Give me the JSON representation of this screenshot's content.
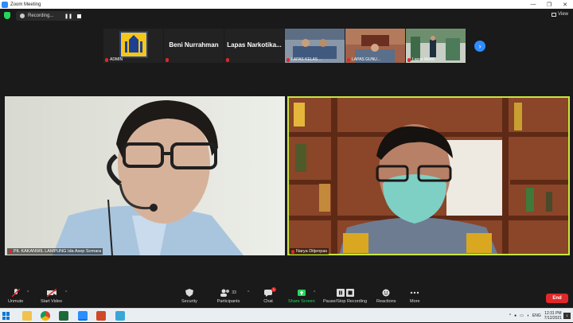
{
  "window": {
    "title": "Zoom Meeting",
    "minimize": "—",
    "maximize": "❐",
    "close": "✕"
  },
  "topbar": {
    "recording_label": "Recording...",
    "pause_glyph": "❚❚",
    "view_label": "View"
  },
  "thumbnails": [
    {
      "name": "ADMIN",
      "kind": "logo"
    },
    {
      "name": "Beni Nurrahman",
      "kind": "name"
    },
    {
      "name": "Lapas Narkotika...",
      "kind": "name"
    },
    {
      "name": "LAPAS KELAS ...",
      "kind": "video"
    },
    {
      "name": "LAPAS GUNU...",
      "kind": "video"
    },
    {
      "name": "Lapas Metro",
      "kind": "video"
    }
  ],
  "next_glyph": "›",
  "main_tiles": [
    {
      "name": "Plt. KAKANWIL LAMPUNG Ida Asep Somara"
    },
    {
      "name": "Narya Ditjenpas"
    }
  ],
  "toolbar": {
    "unmute": "Unmute",
    "start_video": "Start Video",
    "security": "Security",
    "participants": "Participants",
    "participants_count": "33",
    "chat": "Chat",
    "chat_badge": "1",
    "share_screen": "Share Screen",
    "pause_stop_recording": "Pause/Stop Recording",
    "reactions": "Reactions",
    "more": "More",
    "end": "End"
  },
  "taskbar": {
    "language": "ENG",
    "time": "12:31 PM",
    "date": "7/12/2021",
    "notifications": "1"
  },
  "colors": {
    "accent": "#2d8cff",
    "active_speaker": "#c8e63c",
    "end": "#e02828",
    "share": "#23d959"
  }
}
